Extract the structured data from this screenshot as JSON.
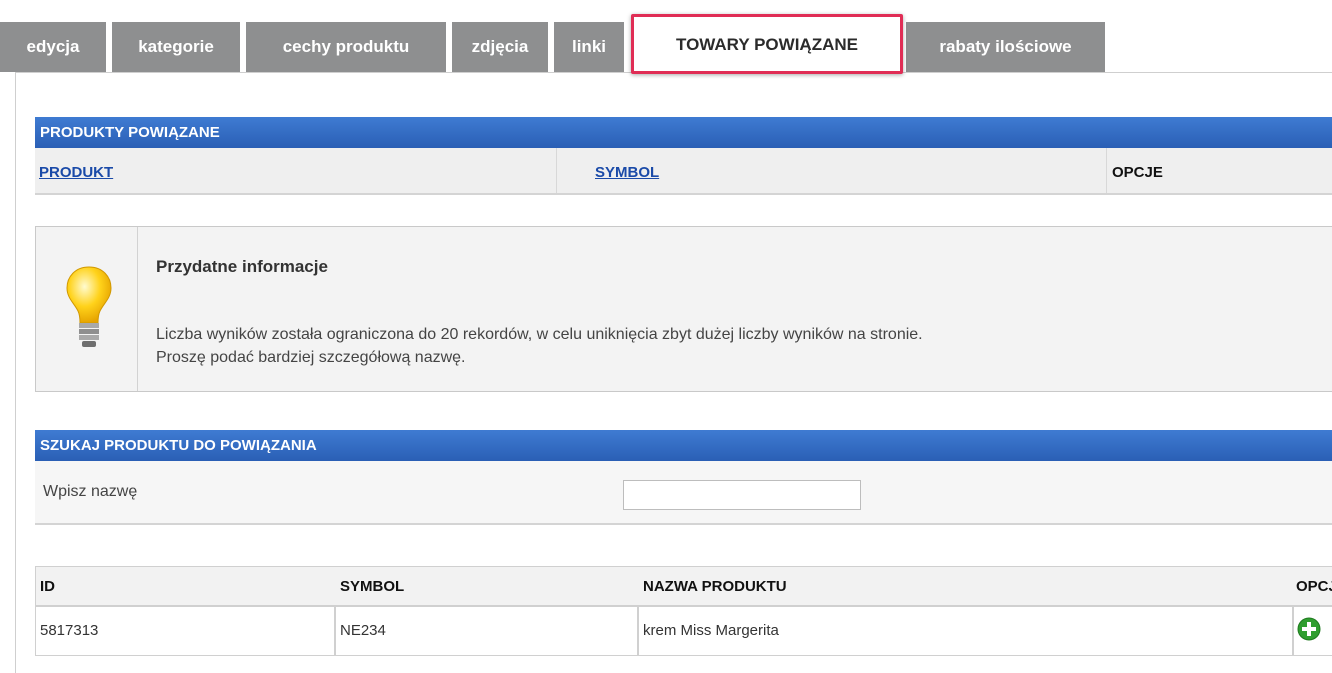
{
  "tabs": [
    {
      "label": "edycja"
    },
    {
      "label": "kategorie"
    },
    {
      "label": "cechy produktu"
    },
    {
      "label": "zdjęcia"
    },
    {
      "label": "linki"
    },
    {
      "label": "TOWARY POWIĄZANE"
    },
    {
      "label": "rabaty ilościowe"
    }
  ],
  "related": {
    "title": "PRODUKTY POWIĄZANE",
    "columns": {
      "product": "PRODUKT",
      "symbol": "SYMBOL",
      "options": "OPCJE"
    }
  },
  "info": {
    "icon": "lightbulb-icon",
    "title": "Przydatne informacje",
    "line1": "Liczba wyników została ograniczona do 20 rekordów, w celu uniknięcia zbyt dużej liczby wyników na stronie.",
    "line2": "Proszę podać bardziej szczegółową nazwę."
  },
  "search": {
    "title": "SZUKAJ PRODUKTU DO POWIĄZANIA",
    "label": "Wpisz nazwę",
    "value": ""
  },
  "results": {
    "headers": {
      "id": "ID",
      "symbol": "SYMBOL",
      "name": "NAZWA PRODUKTU",
      "options": "OPCJ"
    },
    "rows": [
      {
        "id": "5817313",
        "symbol": "NE234",
        "name": "krem Miss Margerita",
        "action_icon": "add-icon"
      }
    ]
  },
  "colors": {
    "tab_gray": "#8e8f90",
    "header_blue": "#2f67bd",
    "highlight": "#e02d55",
    "add_green": "#2f9e2f"
  }
}
